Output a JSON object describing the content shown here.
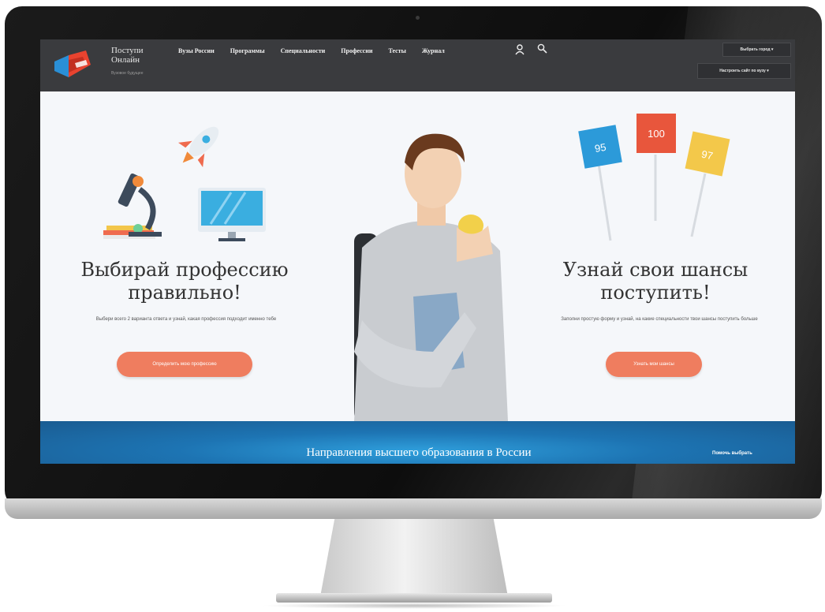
{
  "header": {
    "brand": "Поступи Онлайн",
    "brand_sub": "Вузовое будущее",
    "nav": [
      "Вузы России",
      "Программы",
      "Специальности",
      "Профессии",
      "Тесты",
      "Журнал"
    ],
    "city_button": "Выбрать город",
    "setup_button": "Настроить сайт по вузу"
  },
  "hero": {
    "left": {
      "title": "Выбирай профессию правильно!",
      "description": "Выбери всего 2 варианта ответа и узнай, какая профессия подходит именно тебе",
      "button": "Определить мою профессию"
    },
    "right": {
      "title": "Узнай свои шансы поступить!",
      "description": "Заполни простую форму и узнай, на какие специальности твои шансы поступить больше",
      "button": "Узнать мои шансы",
      "score_signs": [
        "95",
        "100",
        "97"
      ]
    }
  },
  "band": {
    "title": "Направления высшего образования в России",
    "link": "Помочь выбрать"
  },
  "colors": {
    "header_bg": "#3a3b3e",
    "accent_button": "#ef7d5f",
    "band_blue": "#1d74b3"
  }
}
